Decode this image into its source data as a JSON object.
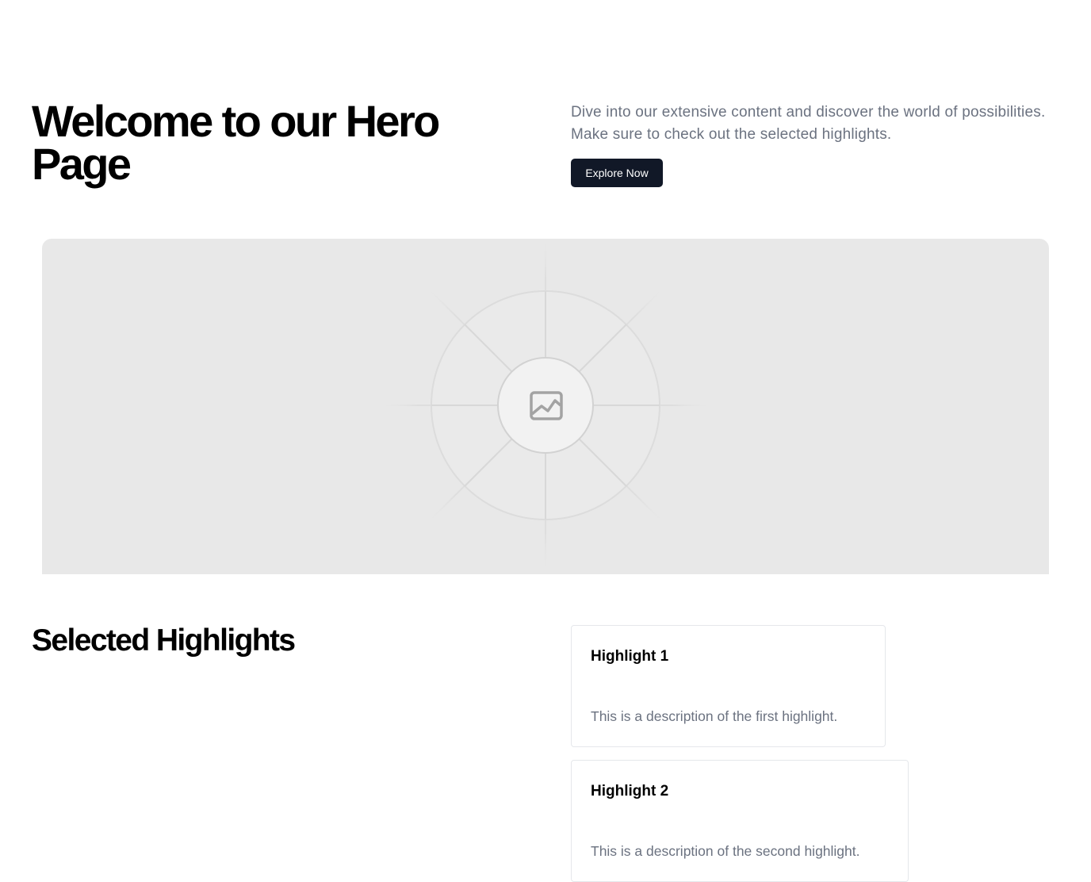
{
  "hero": {
    "title": "Welcome to our Hero Page",
    "description": "Dive into our extensive content and discover the world of possibilities. Make sure to check out the selected highlights.",
    "button_label": "Explore Now"
  },
  "image": {
    "icon": "image-icon",
    "background_color": "#e8e8e8"
  },
  "highlights": {
    "title": "Selected Highlights",
    "items": [
      {
        "title": "Highlight 1",
        "description": "This is a description of the first highlight."
      },
      {
        "title": "Highlight 2",
        "description": "This is a description of the second highlight."
      }
    ]
  },
  "colors": {
    "button_bg": "#111827",
    "muted_text": "#6b7280",
    "card_border": "#e5e7eb"
  }
}
